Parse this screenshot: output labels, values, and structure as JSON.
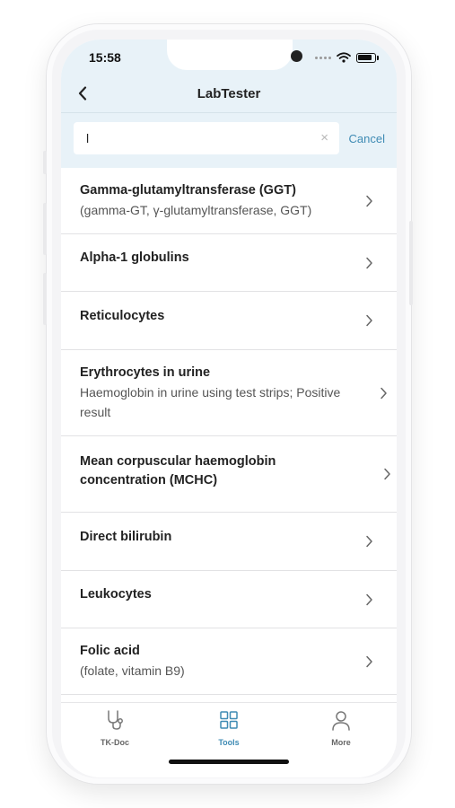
{
  "status_bar": {
    "time": "15:58"
  },
  "nav": {
    "title": "LabTester"
  },
  "search": {
    "value": "l",
    "cancel_label": "Cancel",
    "clear_symbol": "×"
  },
  "results": [
    {
      "title": "Gamma-glutamyltransferase (GGT)",
      "subtitle": "(gamma-GT, γ-glutamyltransferase, GGT)"
    },
    {
      "title": "Alpha-1 globulins",
      "subtitle": ""
    },
    {
      "title": "Reticulocytes",
      "subtitle": ""
    },
    {
      "title": "Erythrocytes in urine",
      "subtitle": "Haemoglobin in urine using test strips; Positive result"
    },
    {
      "title": "Mean corpuscular haemoglobin concentration (MCHC)",
      "subtitle": ""
    },
    {
      "title": "Direct bilirubin",
      "subtitle": ""
    },
    {
      "title": "Leukocytes",
      "subtitle": ""
    },
    {
      "title": "Folic acid",
      "subtitle": "(folate, vitamin B9)"
    }
  ],
  "tabs": [
    {
      "label": "TK-Doc",
      "icon": "stethoscope-icon",
      "active": false
    },
    {
      "label": "Tools",
      "icon": "grid-icon",
      "active": true
    },
    {
      "label": "More",
      "icon": "person-icon",
      "active": false
    }
  ],
  "colors": {
    "accent": "#3f8bb4",
    "header_bg": "#e8f2f8",
    "text": "#222222"
  }
}
